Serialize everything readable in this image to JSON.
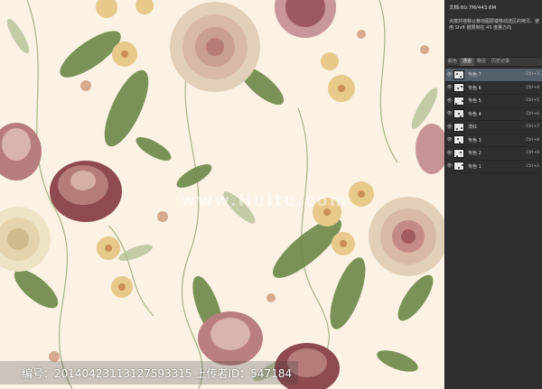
{
  "panel": {
    "doc_size": "文档:60.7M/443.6M",
    "hint": "点按并拖移以移动图层或移动选区的拷贝。使用 Shift 键限制在 45 度量方向",
    "tabs": [
      {
        "label": "颜色"
      },
      {
        "label": "通道"
      },
      {
        "label": "路径"
      },
      {
        "label": "历史记录"
      }
    ],
    "layers": [
      {
        "name": "专色 7",
        "shortcut": "Ctrl+3",
        "selected": true
      },
      {
        "name": "专色 6",
        "shortcut": "Ctrl+4",
        "selected": false
      },
      {
        "name": "专色 5",
        "shortcut": "Ctrl+5",
        "selected": false
      },
      {
        "name": "专色 4",
        "shortcut": "Ctrl+6",
        "selected": false
      },
      {
        "name": "洋红",
        "shortcut": "Ctrl+7",
        "selected": false
      },
      {
        "name": "专色 3",
        "shortcut": "Ctrl+8",
        "selected": false
      },
      {
        "name": "专色 2",
        "shortcut": "Ctrl+9",
        "selected": false
      },
      {
        "name": "专色 1",
        "shortcut": "Ctrl+1",
        "selected": false
      }
    ]
  },
  "canvas": {
    "watermark": "www.Huitu.com"
  },
  "footer": {
    "text": "编号：20140423113127593315 上传者ID：547184"
  },
  "colors": {
    "background": "#fbf2e4",
    "leaf": "#6f8a4c",
    "peony": "#e2cfb8",
    "tulip": "#8e4a4e",
    "gold": "#e7c98a"
  }
}
